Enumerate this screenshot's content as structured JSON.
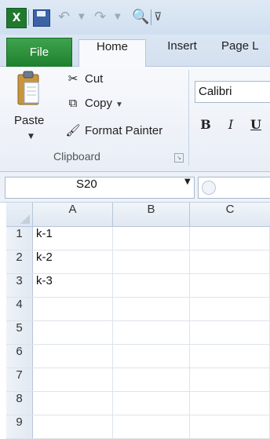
{
  "quick_access": {
    "logo": "X",
    "icons": [
      "excel-logo",
      "save-icon",
      "undo-icon",
      "redo-icon",
      "print-preview-icon",
      "customize-qat-icon"
    ]
  },
  "tabs": [
    {
      "label": "File"
    },
    {
      "label": "Home"
    },
    {
      "label": "Insert"
    },
    {
      "label": "Page L"
    }
  ],
  "clipboard": {
    "paste": "Paste",
    "cut": "Cut",
    "copy": "Copy",
    "format_painter": "Format Painter",
    "group_label": "Clipboard"
  },
  "font": {
    "name": "Calibri",
    "bold": "B",
    "italic": "I",
    "underline": "U"
  },
  "formula_bar": {
    "name_box": "S20"
  },
  "grid": {
    "columns": [
      "A",
      "B",
      "C"
    ],
    "rows": [
      {
        "num": "1",
        "a": "k-1",
        "b": "",
        "c": ""
      },
      {
        "num": "2",
        "a": "k-2",
        "b": "",
        "c": ""
      },
      {
        "num": "3",
        "a": "k-3",
        "b": "",
        "c": ""
      },
      {
        "num": "4",
        "a": "",
        "b": "",
        "c": ""
      },
      {
        "num": "5",
        "a": "",
        "b": "",
        "c": ""
      },
      {
        "num": "6",
        "a": "",
        "b": "",
        "c": ""
      },
      {
        "num": "7",
        "a": "",
        "b": "",
        "c": ""
      },
      {
        "num": "8",
        "a": "",
        "b": "",
        "c": ""
      },
      {
        "num": "9",
        "a": "",
        "b": "",
        "c": ""
      }
    ]
  },
  "colors": {
    "file_tab": "#2e8b3d",
    "ribbon_bg": "#f3f6fb",
    "header_bg": "#e4ebf4"
  }
}
